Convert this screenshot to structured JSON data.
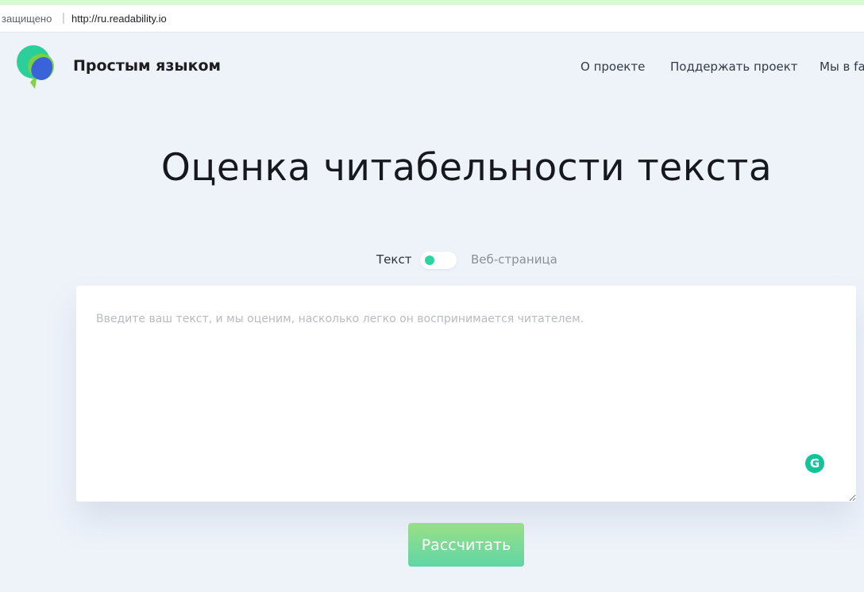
{
  "browser": {
    "security_label": "защищено",
    "separator": "|",
    "url": "http://ru.readability.io"
  },
  "header": {
    "brand": "Простым языком",
    "nav": [
      {
        "label": "О проекте"
      },
      {
        "label": "Поддержать проект"
      },
      {
        "label": "Мы в fa"
      }
    ]
  },
  "main": {
    "title": "Оценка читабельности текста",
    "mode_toggle": {
      "left_label": "Текст",
      "right_label": "Веб-страница",
      "selected": "Текст"
    },
    "input": {
      "value": "",
      "placeholder": "Введите ваш текст, и мы оценим, насколько легко он воспринимается читателем."
    },
    "grammarly_glyph": "G",
    "submit_label": "Рассчитать"
  },
  "colors": {
    "accent_green": "#2dd4a2",
    "button_gradient_top": "#9adf86",
    "button_gradient_bottom": "#5fd6a6",
    "page_background": "#eef3fa",
    "logo_blue": "#3b63d9",
    "logo_green": "#46c06a"
  },
  "icons": {
    "logo": "speech-bubbles-icon",
    "grammarly": "grammarly-icon",
    "toggle": "toggle-switch-icon"
  }
}
